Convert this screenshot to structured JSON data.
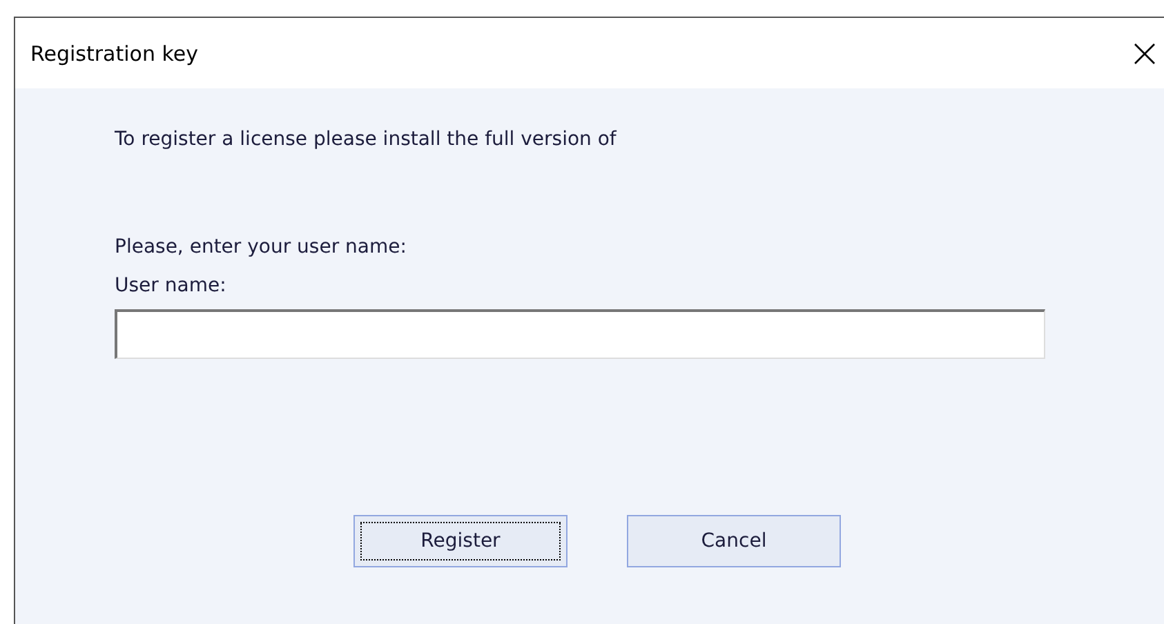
{
  "window": {
    "title": "Registration key"
  },
  "message": "To register a license please install the full version of",
  "prompt": "Please, enter your user name:",
  "user_name": {
    "label": "User name:"
  },
  "buttons": [
    {
      "label": "Register",
      "focused": true
    },
    {
      "label": "Cancel",
      "focused": false
    }
  ]
}
